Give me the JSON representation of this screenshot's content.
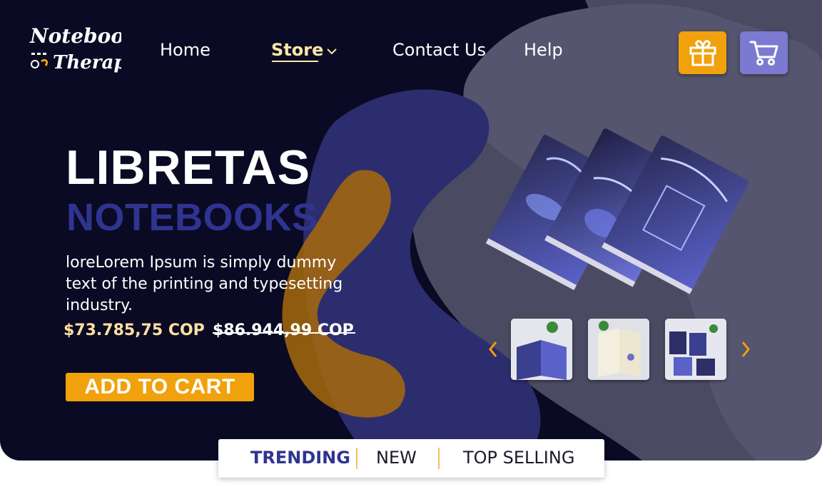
{
  "brand": {
    "logo_line1": "Notebook",
    "logo_line2": "Therapy"
  },
  "nav": {
    "home": "Home",
    "store": "Store",
    "contact": "Contact Us",
    "help": "Help"
  },
  "header_icons": {
    "gift": "gift-icon",
    "cart": "cart-icon"
  },
  "hero": {
    "title_line1": "LIBRETAS",
    "title_line2": "NOTEBOOKS",
    "description": "loreLorem Ipsum is simply dummy text of the printing and typesetting industry.",
    "price": "$73.785,75 COP",
    "old_price": "$86.944,99 COP",
    "add_to_cart": "ADD TO CART"
  },
  "gallery": {
    "prev_icon": "chevron-left-icon",
    "next_icon": "chevron-right-icon",
    "thumbnails": [
      "notebook-open-photo",
      "notebook-pages-photo",
      "notebooks-set-photo"
    ]
  },
  "tabs": {
    "items": [
      "TRENDING",
      "NEW",
      "TOP SELLING"
    ],
    "active": "TRENDING"
  },
  "colors": {
    "background": "#0b0a24",
    "accent_orange": "#f0a10c",
    "accent_purple": "#7c7ad0",
    "title_blue": "#2f3491",
    "price_cream": "#ffe0a0"
  }
}
